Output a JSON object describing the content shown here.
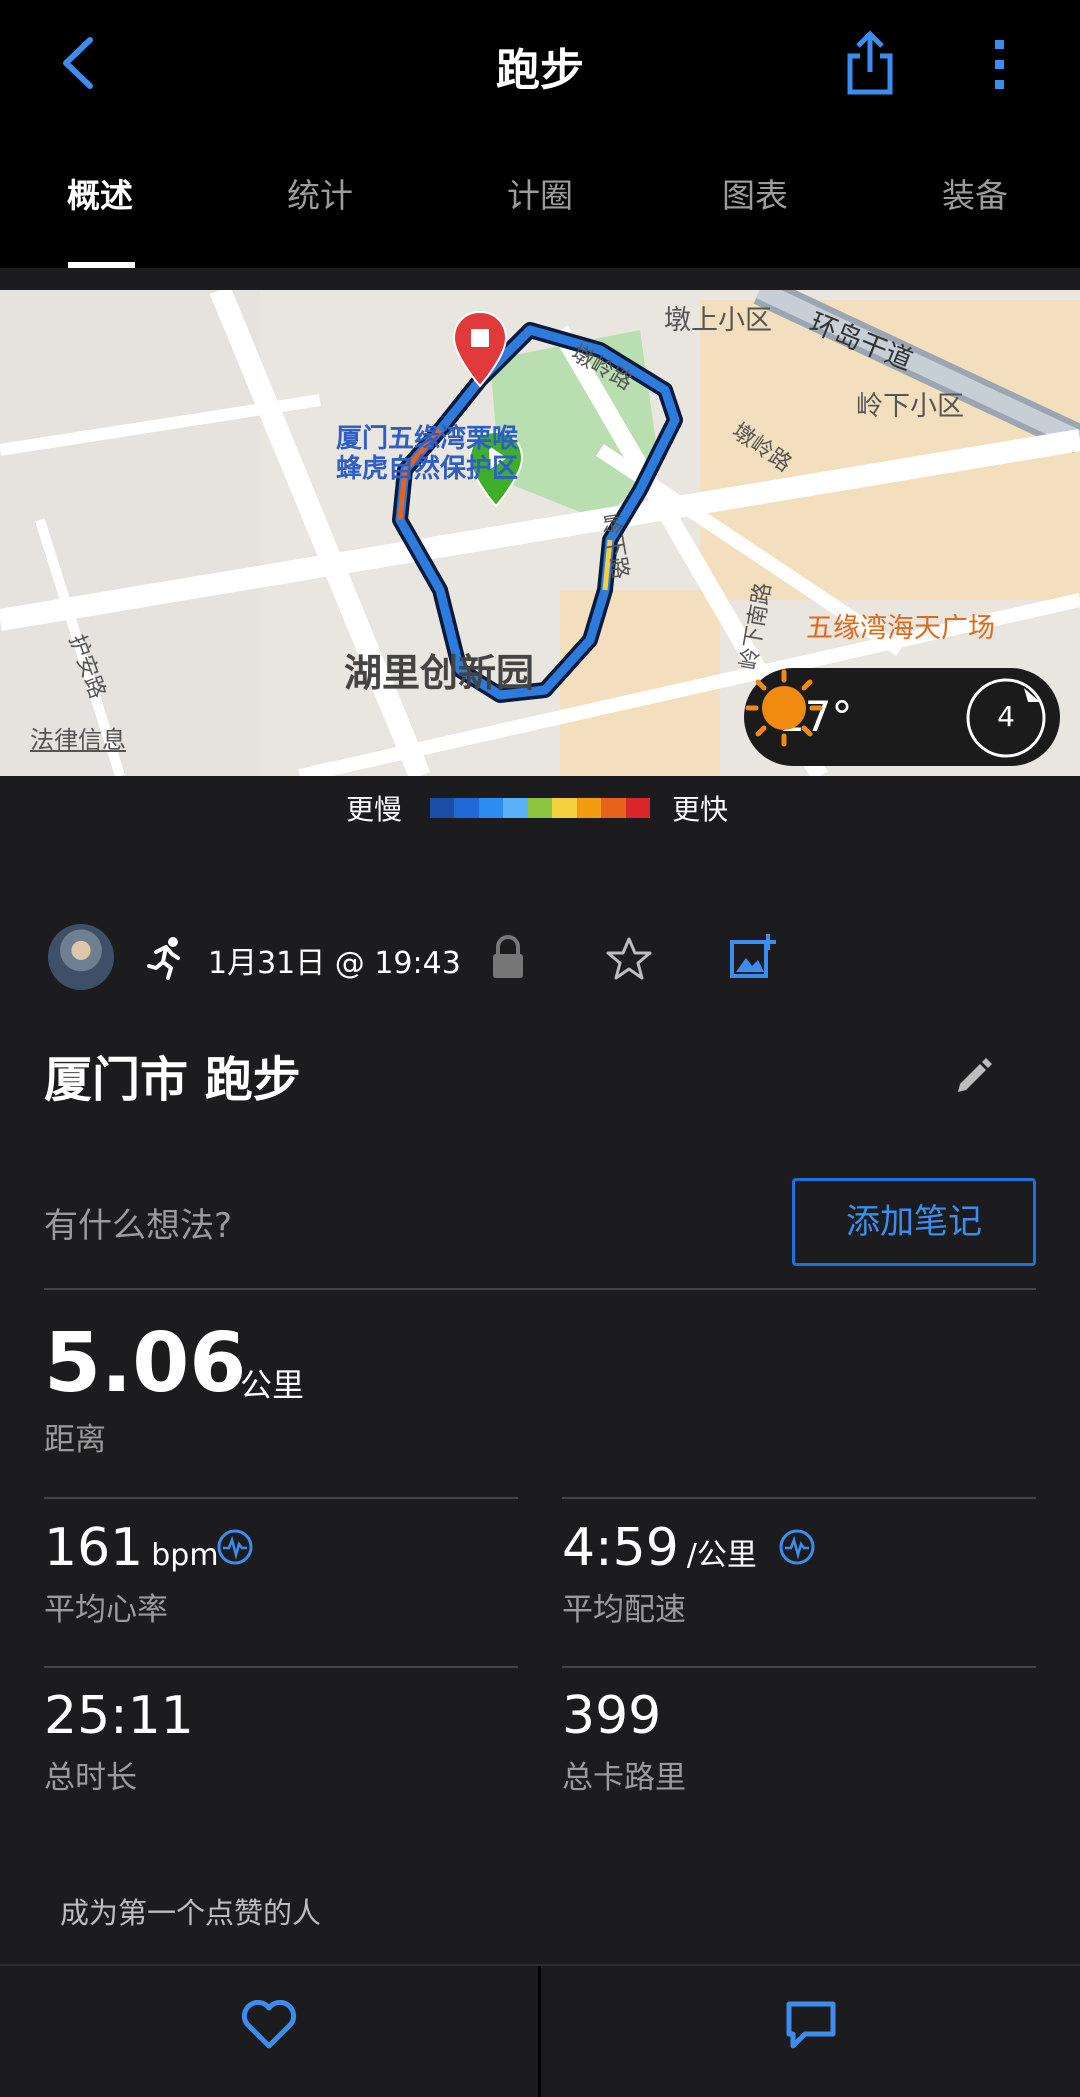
{
  "header": {
    "title": "跑步",
    "tabs": [
      {
        "label": "概述",
        "active": true
      },
      {
        "label": "统计",
        "active": false
      },
      {
        "label": "计圈",
        "active": false
      },
      {
        "label": "图表",
        "active": false
      },
      {
        "label": "装备",
        "active": false
      }
    ]
  },
  "map": {
    "labels": {
      "dunshang": "墩上小区",
      "huandao": "环岛干道",
      "lingxia": "岭下小区",
      "dunling1": "墩岭路",
      "dunling2": "墩岭路",
      "park_line1": "厦门五缘湾栗喉",
      "park_line2": "蜂虎自然保护区",
      "lingxia_road": "岭下路",
      "huyan": "护安路",
      "area": "湖里创新园",
      "mall": "五缘湾海天广场",
      "lingxia_south": "岭下南路",
      "legal": "法律信息"
    },
    "weather": {
      "temperature": "17°",
      "wind": "4"
    }
  },
  "legend": {
    "slow": "更慢",
    "fast": "更快",
    "colors": [
      "#1a4fa8",
      "#1f6ad6",
      "#2d8cf0",
      "#5bb1f5",
      "#8cc63f",
      "#f4d03f",
      "#f39c12",
      "#e8631a",
      "#d9262b"
    ]
  },
  "activity": {
    "date": "1月31日 @ 19:43",
    "name": "厦门市 跑步",
    "note_prompt": "有什么想法?",
    "note_button": "添加笔记"
  },
  "stats": {
    "distance": {
      "value": "5.06",
      "unit": "公里",
      "label": "距离"
    },
    "heart_rate": {
      "value": "161",
      "unit": "bpm",
      "label": "平均心率"
    },
    "pace": {
      "value": "4:59",
      "unit": "/公里",
      "label": "平均配速"
    },
    "duration": {
      "value": "25:11",
      "label": "总时长"
    },
    "calories": {
      "value": "399",
      "label": "总卡路里"
    }
  },
  "social": {
    "like_prompt": "成为第一个点赞的人"
  },
  "colors": {
    "accent": "#1a73d9",
    "background": "#1c1c1e",
    "header": "#000000"
  }
}
